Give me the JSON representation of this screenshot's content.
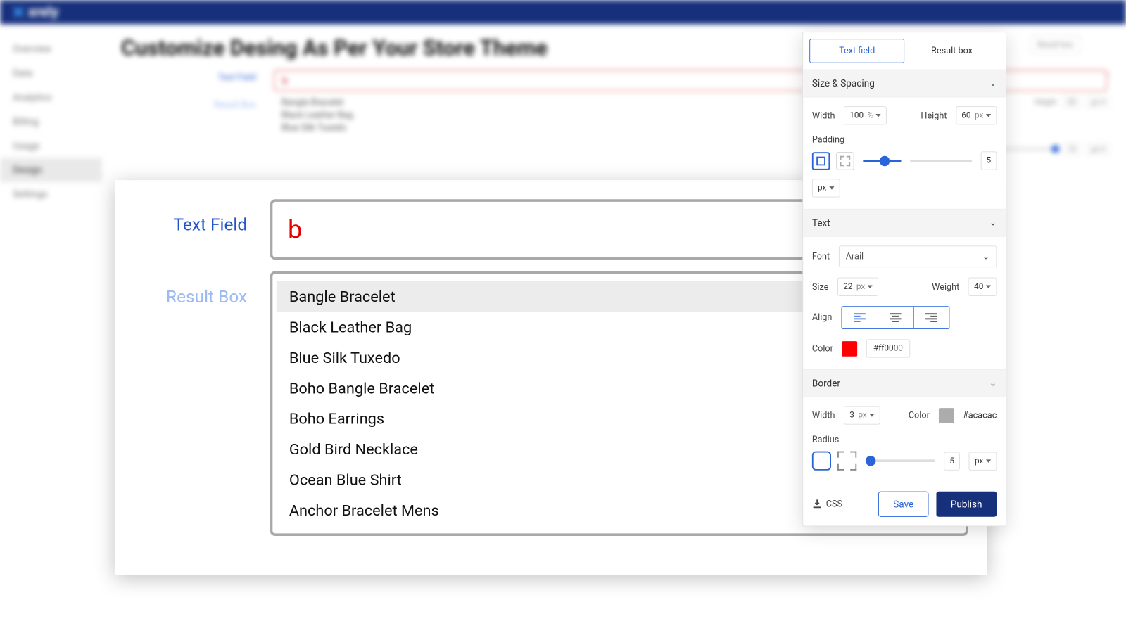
{
  "brand": "xrely",
  "nav": {
    "items": [
      "Overview",
      "Data",
      "Analytics",
      "Billing",
      "Usage",
      "Design",
      "Settings"
    ],
    "active": "Design"
  },
  "page_title": "Customize Desing As Per Your Store Theme",
  "bg": {
    "text_field_label": "Text Field",
    "text_field_value": "b",
    "result_box_label": "Result Box",
    "results": [
      "Bangle Bracelet",
      "Black Leather Bag",
      "Blue Silk Tuxedo"
    ],
    "right_btn": "Result box",
    "height_label": "Height",
    "height_val": "50",
    "height_unit": "px",
    "slider_val": "10",
    "slider_unit": "px"
  },
  "preview": {
    "text_field_label": "Text Field",
    "text_field_value": "b",
    "result_box_label": "Result Box",
    "results": [
      "Bangle Bracelet",
      "Black Leather Bag",
      "Blue Silk Tuxedo",
      "Boho Bangle Bracelet",
      "Boho Earrings",
      "Gold Bird Necklace",
      "Ocean Blue Shirt",
      "Anchor Bracelet Mens"
    ]
  },
  "inspector": {
    "tabs": {
      "text_field": "Text field",
      "result_box": "Result box"
    },
    "size_spacing": {
      "title": "Size & Spacing",
      "width_label": "Width",
      "width_val": "100",
      "width_unit": "%",
      "height_label": "Height",
      "height_val": "60",
      "height_unit": "px",
      "padding_label": "Padding",
      "padding_val": "5",
      "padding_unit": "px"
    },
    "text": {
      "title": "Text",
      "font_label": "Font",
      "font_val": "Arail",
      "size_label": "Size",
      "size_val": "22",
      "size_unit": "px",
      "weight_label": "Weight",
      "weight_val": "40",
      "align_label": "Align",
      "color_label": "Color",
      "color_hex": "#ff0000"
    },
    "border": {
      "title": "Border",
      "width_label": "Width",
      "width_val": "3",
      "width_unit": "px",
      "color_label": "Color",
      "color_hex": "#acacac",
      "radius_label": "Radius",
      "radius_val": "5",
      "radius_unit": "px"
    },
    "footer": {
      "css": "CSS",
      "save": "Save",
      "publish": "Publish"
    }
  },
  "colors": {
    "text_color": "#ff0000",
    "border_color": "#acacac"
  }
}
